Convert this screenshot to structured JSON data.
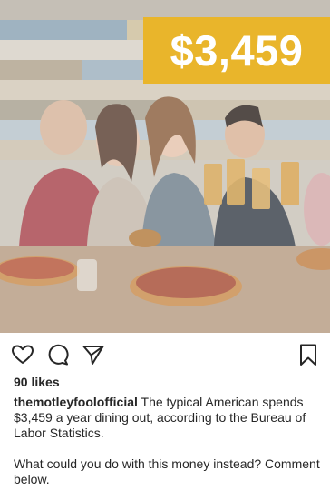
{
  "post": {
    "image": {
      "price_text": "$3,459",
      "banner_color": "#e9b52b",
      "scene": "group-dining-photo"
    },
    "actions": {
      "like_icon": "heart-icon",
      "comment_icon": "comment-icon",
      "share_icon": "paper-plane-icon",
      "save_icon": "bookmark-icon"
    },
    "likes_text": "90 likes",
    "caption": {
      "username": "themotleyfoolofficial",
      "text": " The typical American spends $3,459 a year dining out, according to the Bureau of Labor Statistics.",
      "followup": "What could you do with this money instead? Comment below."
    }
  }
}
